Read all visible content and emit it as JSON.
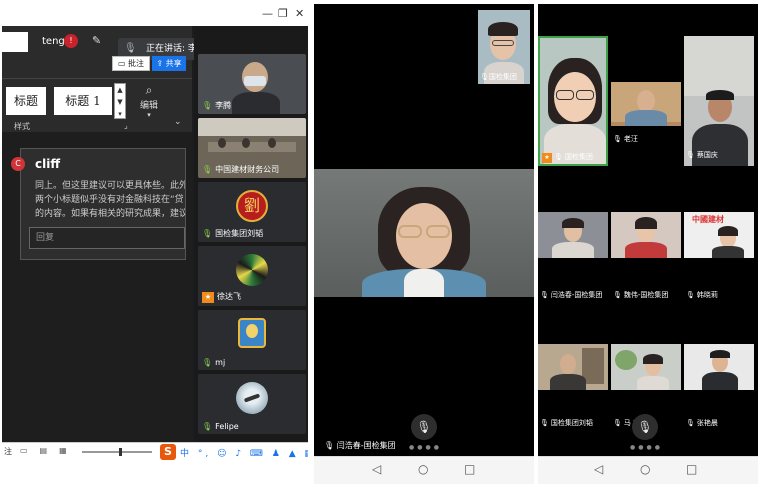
{
  "left_panel": {
    "account_name": "teng",
    "account_badge": "!",
    "speaking": "正在讲话: 李腾; mj;",
    "annotate_btn": "批注",
    "share_btn": "共享",
    "style_boxes": [
      "标题",
      "标题 1"
    ],
    "edit_label": "编辑",
    "styles_group": "样式",
    "comment": {
      "avatar": "C",
      "author": "cliff",
      "lines": [
        "同上。但这里建议可以更具体些。此外",
        "两个小标题似乎没有对金融科技在“贷",
        "的内容。如果有相关的研究成果，建议"
      ],
      "reply_placeholder": "回复"
    },
    "statusbar_left": "注",
    "ime_logo": "S",
    "ime_text": "中 °, ☺ ♪ ⌨ ♟ ▲ ▦",
    "zoom_fraction": 0.55,
    "participants": [
      {
        "name": "李腾",
        "badge": "mic"
      },
      {
        "name": "中国建材财务公司",
        "badge": "mic"
      },
      {
        "name": "国检集团刘韬",
        "badge": "mic",
        "avatar_char": "劉"
      },
      {
        "name": "徐达飞",
        "badge": "host"
      },
      {
        "name": "mj",
        "badge": "mic"
      },
      {
        "name": "Felipe",
        "badge": "mic"
      }
    ]
  },
  "middle_panel": {
    "self_name": "国检集团",
    "speaker_name": "闫浩春-国检集团"
  },
  "right_panel": {
    "participants": [
      {
        "name": "国检集团",
        "badge": "host"
      },
      {
        "name": "老汪",
        "badge": "mic"
      },
      {
        "name": "蔡国庆",
        "badge": "mic"
      },
      {
        "name": "闫浩春-国检集团",
        "badge": "mic"
      },
      {
        "name": "魏伟-国检集团",
        "badge": "mic"
      },
      {
        "name": "韩晓莉",
        "badge": "mic"
      },
      {
        "name": "国检集团刘韬",
        "badge": "mic"
      },
      {
        "name": "马 前",
        "badge": "mic"
      },
      {
        "name": "张艳晨",
        "badge": "mic"
      }
    ],
    "logo_text": "中國建材"
  },
  "colors": {
    "share_blue": "#1a73e8",
    "mic_green": "#8fd14f",
    "host_orange": "#f08c1b",
    "badge_red": "#c8232c"
  },
  "icons": [
    "microphone-icon",
    "pen-icon",
    "search-icon",
    "chevron-down-icon",
    "back-icon",
    "home-icon",
    "recents-icon"
  ]
}
